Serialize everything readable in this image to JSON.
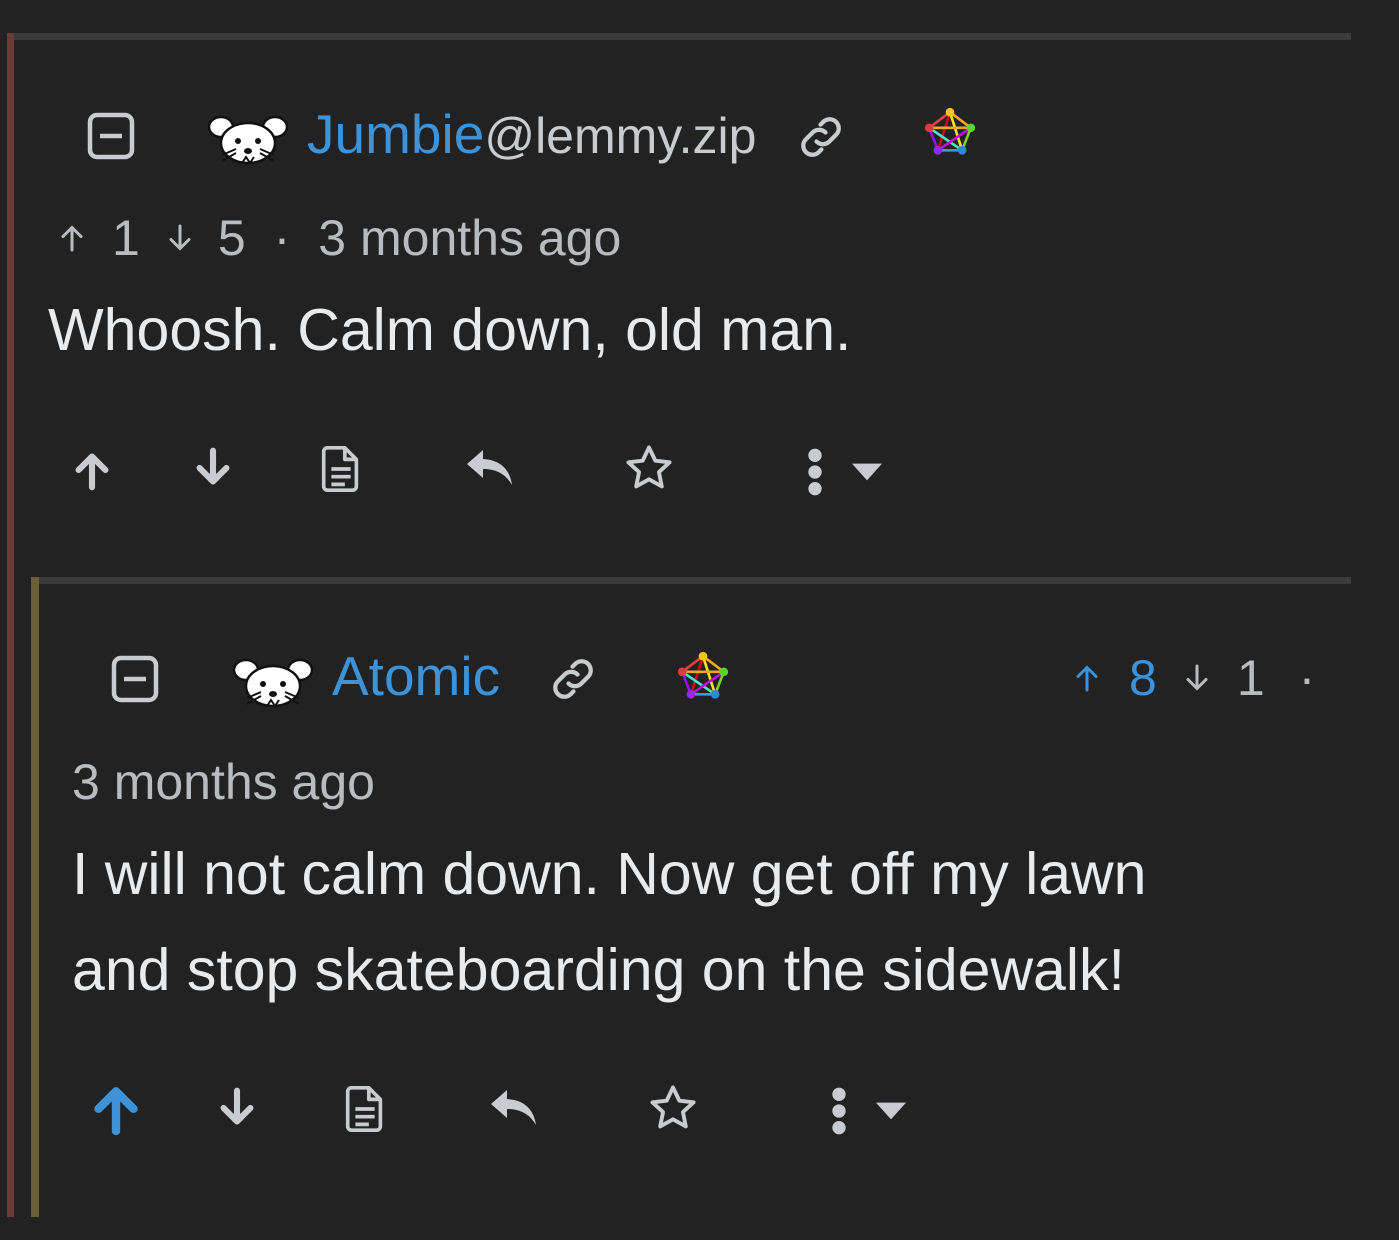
{
  "colors": {
    "background": "#222222",
    "link": "#3e92d8",
    "text": "#e8eaec",
    "muted": "#b8bcc0",
    "upvote_active": "#3e92d8",
    "thread_bar_outer": "#6b3b3b",
    "thread_bar_inner": "#6b5f3a"
  },
  "comments": [
    {
      "username": "Jumbie",
      "instance": "@lemmy.zip",
      "upvotes": "1",
      "downvotes": "5",
      "separator": "·",
      "time": "3 months ago",
      "body": "Whoosh. Calm down, old man.",
      "upvoted": false,
      "icons": [
        "collapse-icon",
        "avatar-mouse-icon",
        "link-icon",
        "fediverse-icon",
        "arrow-up-icon",
        "arrow-down-icon",
        "source-icon",
        "reply-icon",
        "star-icon",
        "more-icon",
        "caret-down-icon"
      ]
    },
    {
      "username": "Atomic",
      "upvotes": "8",
      "downvotes": "1",
      "separator": "·",
      "time": "3 months ago",
      "body_line1": "I will not calm down. Now get off my lawn",
      "body_line2": "and stop skateboarding on the sidewalk!",
      "upvoted": true,
      "icons": [
        "collapse-icon",
        "avatar-mouse-icon",
        "link-icon",
        "fediverse-icon",
        "arrow-up-icon",
        "arrow-down-icon",
        "source-icon",
        "reply-icon",
        "star-icon",
        "more-icon",
        "caret-down-icon"
      ]
    }
  ]
}
